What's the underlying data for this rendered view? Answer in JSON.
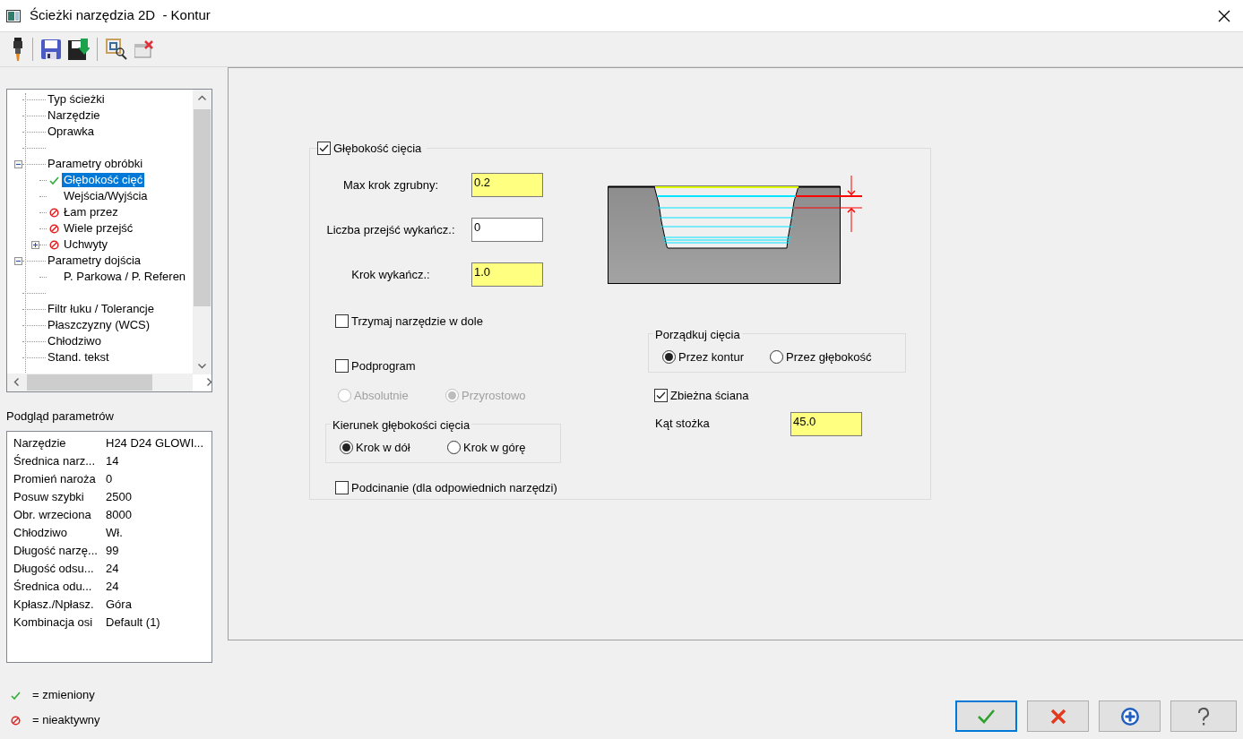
{
  "window": {
    "title": "Ścieżki narzędzia 2D  - Kontur"
  },
  "tree": [
    {
      "kind": "item",
      "label": "Typ ścieżki",
      "selected": false
    },
    {
      "kind": "item",
      "label": "Narzędzie",
      "selected": false
    },
    {
      "kind": "item",
      "label": "Oprawka",
      "selected": false
    },
    {
      "kind": "blank"
    },
    {
      "kind": "item",
      "label": "Parametry obróbki",
      "selected": false,
      "expanded": true,
      "children": [
        {
          "kind": "item",
          "label": "Głębokość cięć",
          "selected": true,
          "changed": true,
          "inactive": false
        },
        {
          "kind": "item",
          "label": "Wejścia/Wyjścia",
          "selected": false,
          "changed": false,
          "inactive": false
        },
        {
          "kind": "item",
          "label": "Łam przez",
          "selected": false,
          "changed": false,
          "inactive": true
        },
        {
          "kind": "item",
          "label": "Wiele przejść",
          "selected": false,
          "changed": false,
          "inactive": true
        },
        {
          "kind": "item",
          "label": "Uchwyty",
          "selected": false,
          "changed": false,
          "inactive": true,
          "expanded": false
        }
      ]
    },
    {
      "kind": "item",
      "label": "Parametry dojścia",
      "selected": false,
      "expanded": true,
      "children": [
        {
          "kind": "item",
          "label": "P. Parkowa / P. Referen",
          "selected": false,
          "changed": false,
          "inactive": false
        }
      ]
    },
    {
      "kind": "blank"
    },
    {
      "kind": "item",
      "label": "Filtr łuku / Tolerancje",
      "selected": false
    },
    {
      "kind": "item",
      "label": "Płaszczyzny (WCS)",
      "selected": false
    },
    {
      "kind": "item",
      "label": "Chłodziwo",
      "selected": false
    },
    {
      "kind": "item",
      "label": "Stand. tekst",
      "selected": false
    }
  ],
  "preview": {
    "title": "Podgląd parametrów",
    "rows": [
      {
        "label": "Narzędzie",
        "value": "H24 D24 GLOWI..."
      },
      {
        "label": "Średnica narz...",
        "value": "14"
      },
      {
        "label": "Promień naroża",
        "value": "0"
      },
      {
        "label": "Posuw szybki",
        "value": "2500"
      },
      {
        "label": "Obr. wrzeciona",
        "value": "8000"
      },
      {
        "label": "Chłodziwo",
        "value": "Wł."
      },
      {
        "label": "Długość narzę...",
        "value": "99"
      },
      {
        "label": "Długość odsu...",
        "value": "24"
      },
      {
        "label": "Średnica odu...",
        "value": "24"
      },
      {
        "label": "Kpłasz./Npłasz.",
        "value": "Góra"
      },
      {
        "label": "Kombinacja osi",
        "value": "Default (1)"
      }
    ]
  },
  "legend": [
    {
      "kind": "changed",
      "text": "= zmieniony"
    },
    {
      "kind": "inactive",
      "text": "= nieaktywny"
    }
  ],
  "depth_group": {
    "label": "Głębokość cięcia",
    "checked": true
  },
  "fields": [
    {
      "label": "Max krok zgrubny:",
      "value": "0.2",
      "highlighted": true
    },
    {
      "label": "Liczba przejść wykańcz.:",
      "value": "0",
      "highlighted": false
    },
    {
      "label": "Krok wykańcz.:",
      "value": "1.0",
      "highlighted": true
    }
  ],
  "keep_down": {
    "label": "Trzymaj narzędzie w dole",
    "checked": false
  },
  "subprogram": {
    "label": "Podprogram",
    "checked": false,
    "options": [
      {
        "label": "Absolutnie",
        "selected": false,
        "disabled": true
      },
      {
        "label": "Przyrostowo",
        "selected": true,
        "disabled": true
      }
    ]
  },
  "direction": {
    "title": "Kierunek głębokości cięcia",
    "options": [
      {
        "label": "Krok w dół",
        "selected": true,
        "disabled": false
      },
      {
        "label": "Krok w górę",
        "selected": false,
        "disabled": false
      }
    ]
  },
  "undercut": {
    "label": "Podcinanie (dla odpowiednich narzędzi)",
    "checked": false
  },
  "order": {
    "title": "Porządkuj cięcia",
    "options": [
      {
        "label": "Przez kontur",
        "selected": true,
        "disabled": false
      },
      {
        "label": "Przez głębokość",
        "selected": false,
        "disabled": false
      }
    ]
  },
  "taper": {
    "label": "Zbieżna ściana",
    "checked": true
  },
  "taper_angle": {
    "label": "Kąt stożka",
    "value": "45.0",
    "highlighted": true
  },
  "buttons": [
    {
      "kind": "ok",
      "default": true
    },
    {
      "kind": "cancel",
      "default": false
    },
    {
      "kind": "add",
      "default": false
    },
    {
      "kind": "help",
      "default": false
    }
  ]
}
